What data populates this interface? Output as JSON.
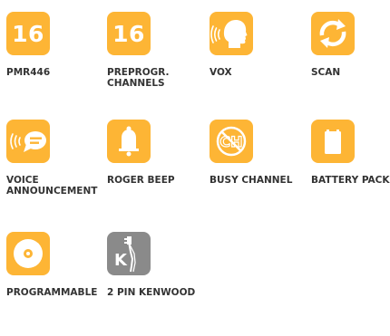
{
  "colors": {
    "orange": "#FDB535",
    "gray": "#8A8A8A",
    "icon": "#FFFFFF",
    "label": "#333333"
  },
  "features": [
    {
      "label": "PMR446",
      "tile_text": "16",
      "icon": "pmr-16-icon",
      "tile_color": "orange"
    },
    {
      "label": "PREPROGR.\nCHANNELS",
      "tile_text": "16",
      "icon": "preprogrammed-16-icon",
      "tile_color": "orange"
    },
    {
      "label": "VOX",
      "icon": "voice-head-icon",
      "tile_color": "orange"
    },
    {
      "label": "SCAN",
      "icon": "scan-arrows-icon",
      "tile_color": "orange"
    },
    {
      "label": "VOICE\nANNOUNCEMENT",
      "icon": "speech-bubble-icon",
      "tile_color": "orange"
    },
    {
      "label": "ROGER BEEP",
      "icon": "bell-icon",
      "tile_color": "orange"
    },
    {
      "label": "BUSY CHANNEL",
      "icon": "no-channel-icon",
      "tile_color": "orange"
    },
    {
      "label": "BATTERY PACK",
      "icon": "battery-icon",
      "tile_color": "orange"
    },
    {
      "label": "PROGRAMMABLE",
      "icon": "disc-icon",
      "tile_color": "orange"
    },
    {
      "label": "2 PIN KENWOOD",
      "tile_text": "K",
      "icon": "kenwood-earpiece-icon",
      "tile_color": "gray"
    }
  ]
}
